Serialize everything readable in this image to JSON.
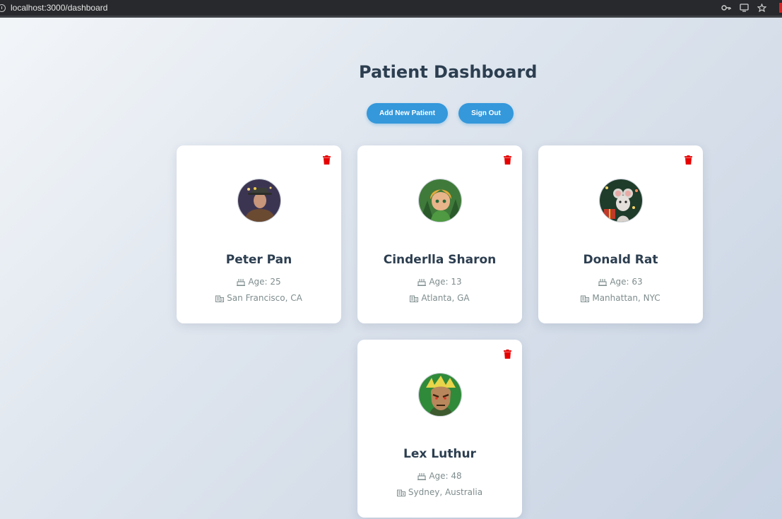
{
  "browser": {
    "url": "localhost:3000/dashboard",
    "icons": [
      "info-icon",
      "key-icon",
      "cast-icon",
      "star-icon"
    ]
  },
  "page": {
    "title": "Patient Dashboard",
    "buttons": {
      "add": "Add New Patient",
      "signout": "Sign Out"
    },
    "accent_color": "#3498db",
    "delete_color": "#e60000"
  },
  "patients": [
    {
      "name": "Peter Pan",
      "age": "Age: 25",
      "location": "San Francisco, CA",
      "avatar": "adventurer-avatar-icon"
    },
    {
      "name": "Cinderlla Sharon",
      "age": "Age: 13",
      "location": "Atlanta, GA",
      "avatar": "elf-girl-avatar-icon"
    },
    {
      "name": "Donald Rat",
      "age": "Age: 63",
      "location": "Manhattan, NYC",
      "avatar": "mouse-avatar-icon"
    },
    {
      "name": "Lex Luthur",
      "age": "Age: 48",
      "location": "Sydney, Australia",
      "avatar": "villain-avatar-icon"
    }
  ]
}
